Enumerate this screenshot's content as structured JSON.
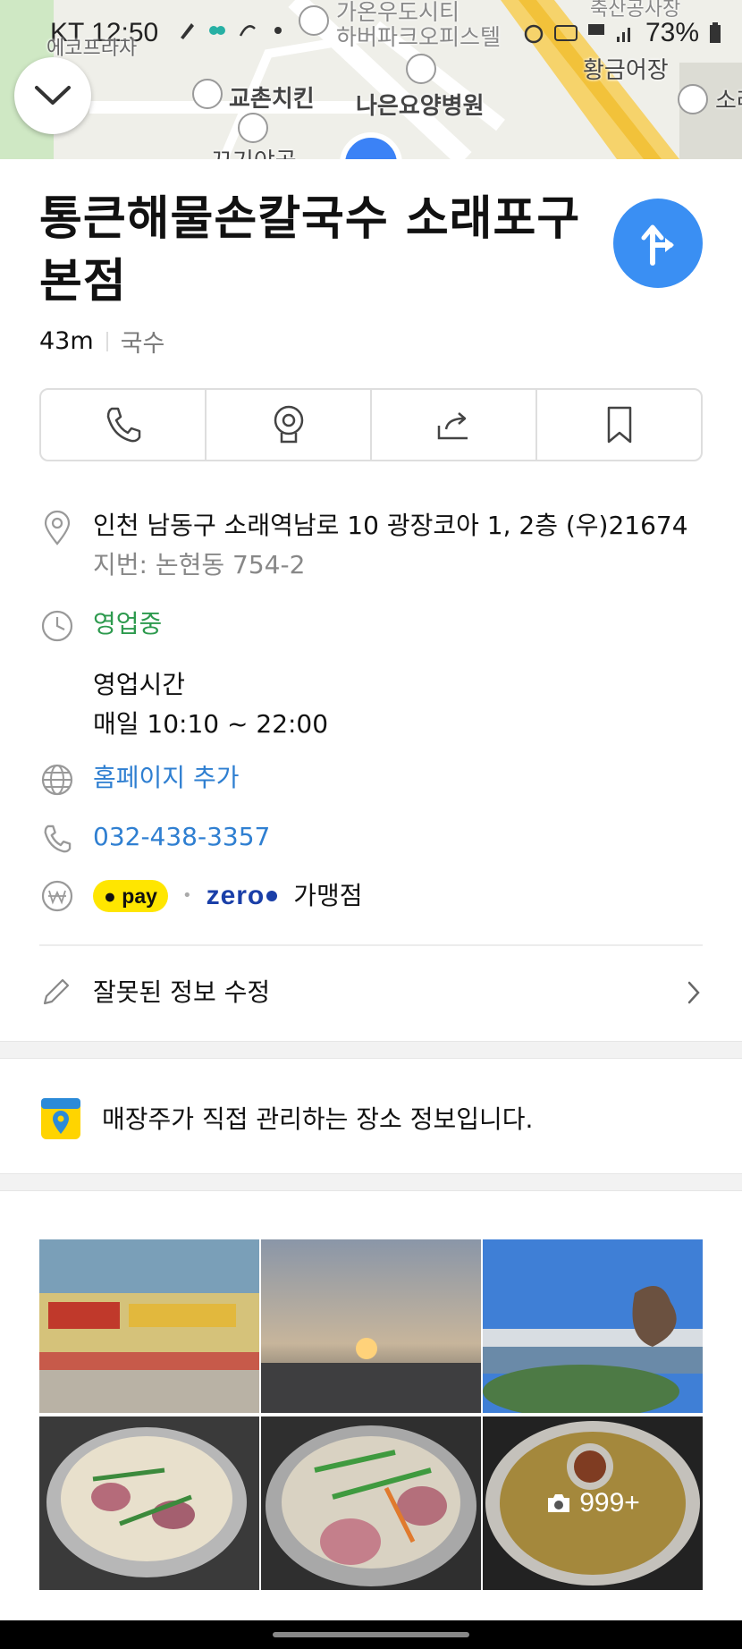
{
  "status_bar": {
    "carrier_time": "KT 12:50",
    "battery": "73%"
  },
  "map": {
    "labels": [
      "에코프라자",
      "가온우도시티",
      "하버파크오피스텔",
      "황금어장",
      "교촌치킨",
      "나은요양병원",
      "꼬기야곱",
      "소래",
      "축산공사장"
    ]
  },
  "place": {
    "title": "통큰해물손칼국수 소래포구본점",
    "distance": "43m",
    "category": "국수"
  },
  "actions": [
    {
      "name": "call",
      "icon": "phone-icon"
    },
    {
      "name": "roadview",
      "icon": "roadview-icon"
    },
    {
      "name": "share",
      "icon": "share-icon"
    },
    {
      "name": "save",
      "icon": "bookmark-icon"
    }
  ],
  "info": {
    "address": "인천 남동구 소래역남로 10 광장코아 1, 2층 (우)21674",
    "jibun": "지번: 논현동 754-2",
    "status": "영업중",
    "hours_label": "영업시간",
    "hours_value": "매일 10:10 ~ 22:00",
    "homepage": "홈페이지 추가",
    "phone": "032-438-3357",
    "pay_badge": "pay",
    "zero_label": "zero",
    "pay_suffix": "가맹점",
    "edit_label": "잘못된 정보 수정"
  },
  "owner_notice": "매장주가 직접 관리하는 장소 정보입니다.",
  "photos": {
    "count_label": "999+"
  },
  "colors": {
    "route_blue": "#3a8ff3",
    "open_green": "#2d9a4e",
    "link_blue": "#2f7fd1",
    "pay_yellow": "#ffe600"
  }
}
